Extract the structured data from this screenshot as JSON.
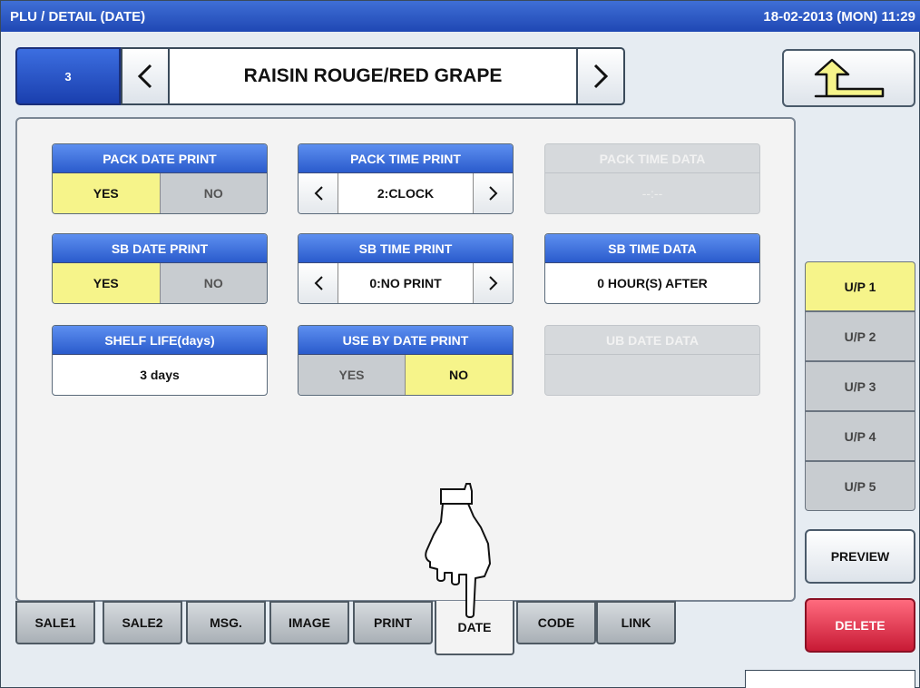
{
  "titlebar": {
    "title": "PLU / DETAIL (DATE)",
    "clock": "18-02-2013 (MON)  11:29"
  },
  "plu": {
    "number": "3",
    "name": "RAISIN ROUGE/RED GRAPE"
  },
  "icons": {
    "prev": "chevron-left-icon",
    "next": "chevron-right-icon",
    "back": "return-arrow-icon",
    "pointer": "pointing-hand-icon"
  },
  "cards": {
    "pack_date_print": {
      "title": "PACK DATE PRINT",
      "yes": "YES",
      "no": "NO",
      "selected": "YES"
    },
    "pack_time_print": {
      "title": "PACK TIME PRINT",
      "value": "2:CLOCK"
    },
    "pack_time_data": {
      "title": "PACK TIME DATA",
      "value": "--:--"
    },
    "sb_date_print": {
      "title": "SB DATE PRINT",
      "yes": "YES",
      "no": "NO",
      "selected": "YES"
    },
    "sb_time_print": {
      "title": "SB TIME PRINT",
      "value": "0:NO PRINT"
    },
    "sb_time_data": {
      "title": "SB TIME DATA",
      "value": "0 HOUR(S) AFTER"
    },
    "shelf_life": {
      "title": "SHELF LIFE(days)",
      "value": "3 days"
    },
    "use_by_date_print": {
      "title": "USE BY DATE PRINT",
      "yes": "YES",
      "no": "NO",
      "selected": "NO"
    },
    "ub_date_data": {
      "title": "UB DATE DATA",
      "value": ""
    }
  },
  "tabs": [
    {
      "label": "SALE1"
    },
    {
      "label": "SALE2"
    },
    {
      "label": "MSG."
    },
    {
      "label": "IMAGE"
    },
    {
      "label": "PRINT"
    },
    {
      "label": "DATE"
    },
    {
      "label": "CODE"
    },
    {
      "label": "LINK"
    }
  ],
  "active_tab": "DATE",
  "unit_prices": [
    {
      "label": "U/P 1"
    },
    {
      "label": "U/P 2"
    },
    {
      "label": "U/P 3"
    },
    {
      "label": "U/P 4"
    },
    {
      "label": "U/P 5"
    }
  ],
  "selected_unit_price": "U/P 1",
  "buttons": {
    "preview": "PREVIEW",
    "delete": "DELETE"
  },
  "colors": {
    "title_blue": "#1f47b4",
    "selected_yellow": "#f6f48a",
    "delete_red": "#c81a35"
  }
}
